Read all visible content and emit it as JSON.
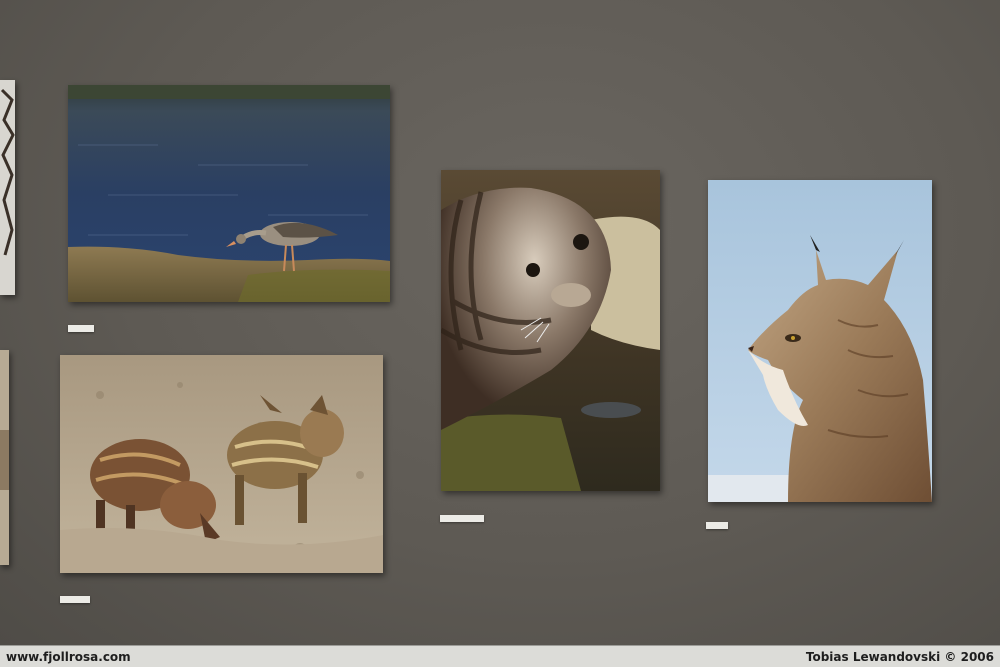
{
  "footer": {
    "site": "www.fjollrosa.com",
    "credit": "Tobias Lewandovski © 2006"
  },
  "colors": {
    "wall": "#5e5a54",
    "footer_bg": "#dcdcd8",
    "footer_text": "#1e1e1e"
  },
  "photos": [
    {
      "subject": "greylag goose on shore"
    },
    {
      "subject": "wild boar piglets"
    },
    {
      "subject": "grey seal"
    },
    {
      "subject": "lynx portrait"
    }
  ]
}
